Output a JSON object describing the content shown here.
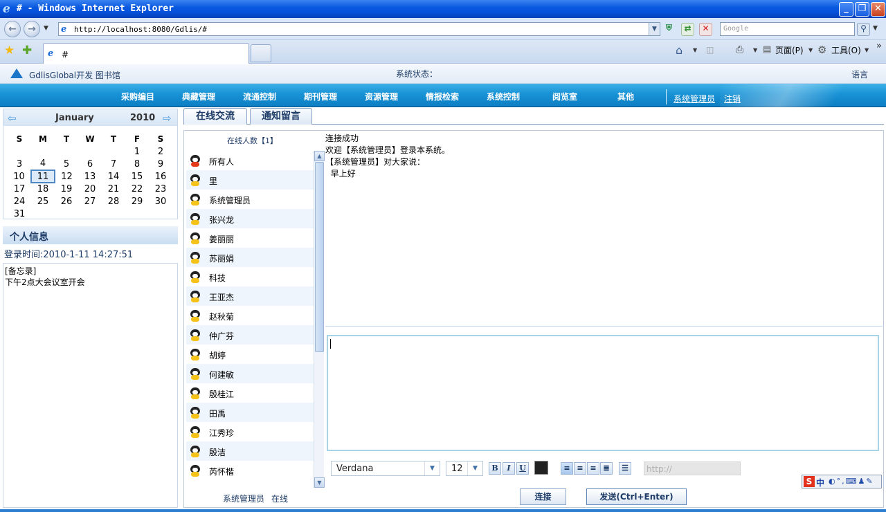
{
  "browser": {
    "title": "# - Windows Internet Explorer",
    "url": "http://localhost:8080/Gdlis/#",
    "search_placeholder": "Google",
    "tab_title": "#",
    "cmd_page": "页面(P)",
    "cmd_tools": "工具(O)",
    "more": "»"
  },
  "app": {
    "brand": "GdlisGlobal开发 图书馆",
    "status_label": "系统状态：",
    "language": "语言"
  },
  "nav": {
    "items": [
      "采购编目",
      "典藏管理",
      "流通控制",
      "期刊管理",
      "资源管理",
      "情报检索",
      "系统控制",
      "阅览室",
      "其他"
    ],
    "user": "系统管理员",
    "logout": "注销"
  },
  "calendar": {
    "month": "January",
    "year": "2010",
    "weekdays": [
      "S",
      "M",
      "T",
      "W",
      "T",
      "F",
      "S"
    ],
    "weeks": [
      [
        "",
        "",
        "",
        "",
        "",
        "1",
        "2"
      ],
      [
        "3",
        "4",
        "5",
        "6",
        "7",
        "8",
        "9"
      ],
      [
        "10",
        "11",
        "12",
        "13",
        "14",
        "15",
        "16"
      ],
      [
        "17",
        "18",
        "19",
        "20",
        "21",
        "22",
        "23"
      ],
      [
        "24",
        "25",
        "26",
        "27",
        "28",
        "29",
        "30"
      ],
      [
        "31",
        "",
        "",
        "",
        "",
        "",
        ""
      ]
    ],
    "selected": "11"
  },
  "profile": {
    "title": "个人信息",
    "login_time": "登录时间:2010-1-11 14:27:51",
    "memo_lines": [
      "[备忘录]",
      "下午2点大会议室开会"
    ]
  },
  "chat": {
    "tabs": [
      "在线交流",
      "通知留言"
    ],
    "online_count": "在线人数【1】",
    "users": [
      "所有人",
      "里",
      "系统管理员",
      "张兴龙",
      "姜丽丽",
      "苏丽娟",
      "科技",
      "王亚杰",
      "赵秋菊",
      "仲广芬",
      "胡婷",
      "何建敏",
      "殷桂江",
      "田禹",
      "江秀珍",
      "殷洁",
      "芮怀楷"
    ],
    "me": {
      "name": "系统管理员",
      "status": "在线"
    },
    "messages": [
      "连接成功",
      "欢迎【系统管理员】登录本系统。",
      "【系统管理员】对大家说：",
      "  早上好"
    ],
    "input_value": "",
    "editor": {
      "font": "Verdana",
      "size": "12",
      "bold": "B",
      "italic": "I",
      "underline": "U",
      "link_placeholder": "http://"
    },
    "connect_label": "连接",
    "send_label": "发送(Ctrl+Enter)"
  },
  "ime": {
    "s": "S",
    "zh": "中",
    "rest": "◐°,⌨♟✎"
  }
}
